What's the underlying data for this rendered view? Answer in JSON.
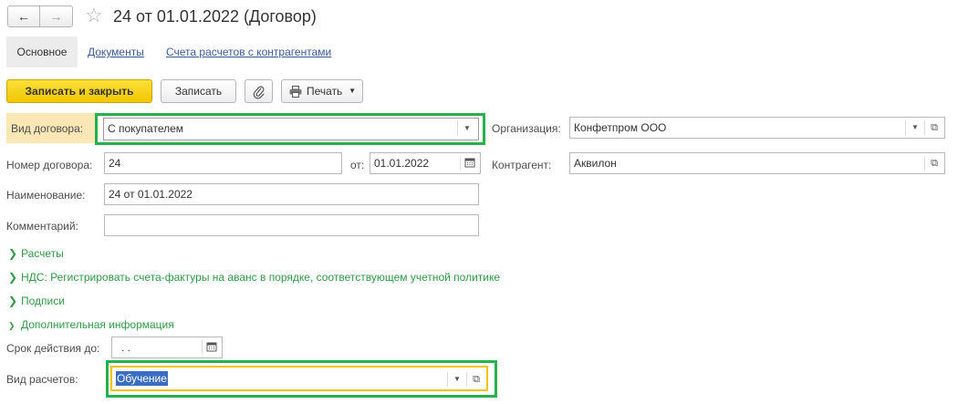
{
  "window": {
    "title": "24 от 01.01.2022 (Договор)"
  },
  "nav": {
    "back_icon": "arrow-left-icon",
    "forward_icon": "arrow-right-icon",
    "favorite_icon": "star-icon"
  },
  "tabs": [
    {
      "label": "Основное",
      "active": true
    },
    {
      "label": "Документы",
      "active": false
    },
    {
      "label": "Счета расчетов с контрагентами",
      "active": false
    }
  ],
  "toolbar": {
    "save_close_label": "Записать и закрыть",
    "save_label": "Записать",
    "attach_icon": "paperclip-icon",
    "print_label": "Печать"
  },
  "form": {
    "contract_type": {
      "label": "Вид договора:",
      "value": "С покупателем"
    },
    "organization": {
      "label": "Организация:",
      "value": "Конфетпром ООО"
    },
    "contract_number": {
      "label": "Номер договора:",
      "value": "24"
    },
    "date": {
      "label": "от:",
      "value": "01.01.2022"
    },
    "counterparty": {
      "label": "Контрагент:",
      "value": "Аквилон"
    },
    "name": {
      "label": "Наименование:",
      "value": "24 от 01.01.2022"
    },
    "comment": {
      "label": "Комментарий:",
      "value": ""
    }
  },
  "groups": [
    {
      "label": "Расчеты",
      "expanded": false
    },
    {
      "label": "НДС: Регистрировать счета-фактуры на аванс в порядке, соответствующем учетной политике",
      "expanded": false
    },
    {
      "label": "Подписи",
      "expanded": false
    },
    {
      "label": "Дополнительная информация",
      "expanded": true
    }
  ],
  "additional": {
    "valid_until": {
      "label": "Срок действия до:",
      "value": " .  ."
    },
    "payment_type": {
      "label": "Вид расчетов:",
      "value": "Обучение"
    }
  },
  "colors": {
    "accent_button": "#f2c600",
    "highlight_frame": "#25b14b",
    "group_text": "#2f9a46",
    "link": "#3b5a98",
    "selection": "#3a6ec4"
  }
}
